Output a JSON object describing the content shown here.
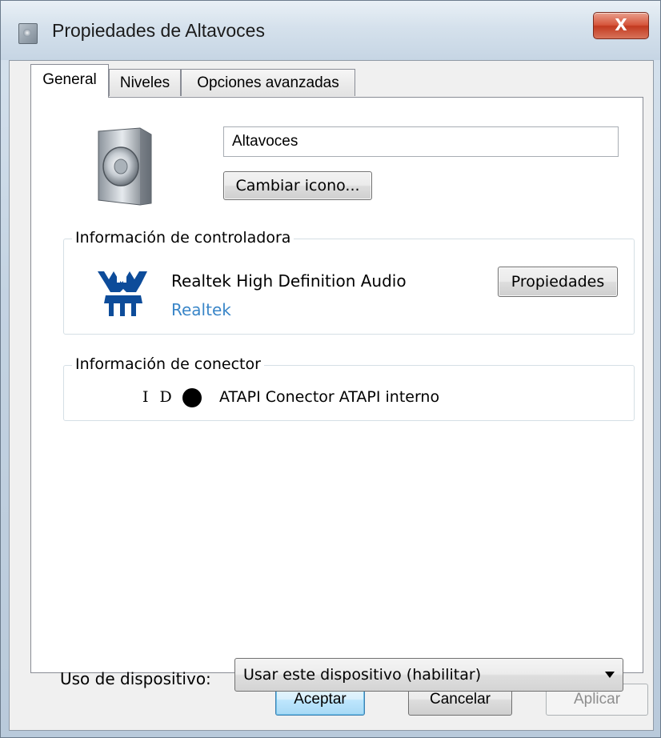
{
  "window": {
    "title": "Propiedades de Altavoces",
    "close_label": "X"
  },
  "tabs": [
    {
      "label": "General",
      "active": true
    },
    {
      "label": "Niveles",
      "active": false
    },
    {
      "label": "Opciones avanzadas",
      "active": false
    }
  ],
  "device": {
    "icon": "speaker-icon",
    "name_value": "Altavoces",
    "change_icon_label": "Cambiar icono..."
  },
  "driver_group": {
    "legend": "Información de controladora",
    "logo": "realtek-logo",
    "driver_name": "Realtek High Definition Audio",
    "vendor_link": "Realtek",
    "properties_label": "Propiedades",
    "link_color": "#3a86c8"
  },
  "connector_group": {
    "legend": "Información de conector",
    "id_label": "I D",
    "connector_color": "#000000",
    "connector_text": "ATAPI Conector ATAPI interno"
  },
  "usage": {
    "label": "Uso de dispositivo:",
    "selected_value": "Usar este dispositivo (habilitar)"
  },
  "footer": {
    "ok_label": "Aceptar",
    "cancel_label": "Cancelar",
    "apply_label": "Aplicar"
  }
}
